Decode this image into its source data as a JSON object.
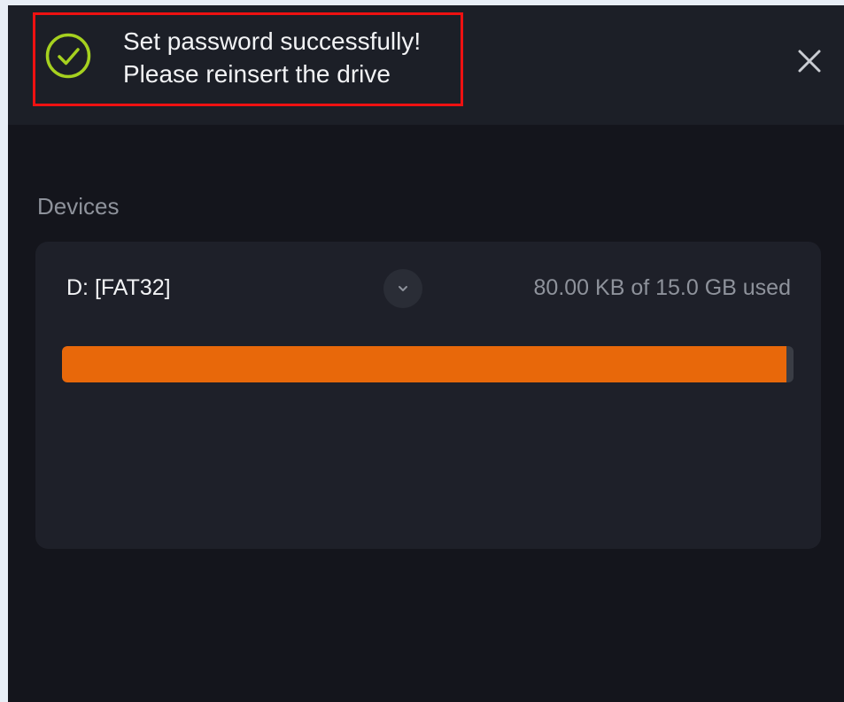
{
  "notification": {
    "line1": "Set password successfully!",
    "line2": "Please reinsert the drive",
    "icon": "check-circle-icon",
    "icon_color": "#a6d11f"
  },
  "close_icon": "close-icon",
  "devices": {
    "section_label": "Devices",
    "items": [
      {
        "name": "D: [FAT32]",
        "usage_text": "80.00 KB of 15.0 GB used",
        "used_fraction": 0.99,
        "bar_color": "#e8680a",
        "expand_icon": "chevron-down-icon"
      }
    ]
  }
}
